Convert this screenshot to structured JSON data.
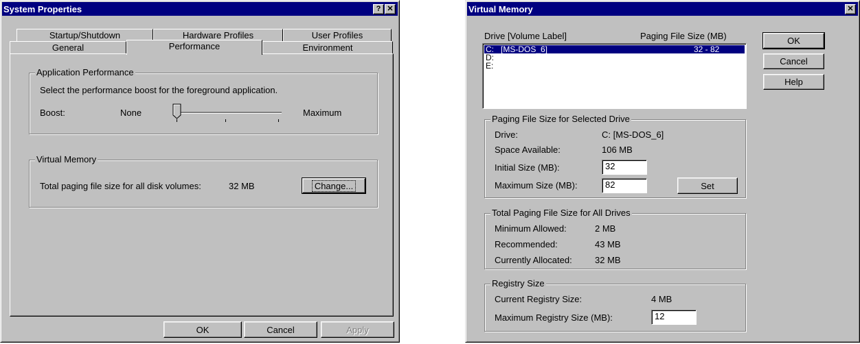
{
  "sysprops": {
    "title": "System Properties",
    "help_btn": "?",
    "close_btn": "✕",
    "tabs_back": [
      "Startup/Shutdown",
      "Hardware Profiles",
      "User Profiles"
    ],
    "tabs_front": [
      "General",
      "Performance",
      "Environment"
    ],
    "app_perf": {
      "legend": "Application Performance",
      "description": "Select the performance boost for the foreground application.",
      "boost_label": "Boost:",
      "none_label": "None",
      "max_label": "Maximum",
      "boost_value": 0
    },
    "vm": {
      "legend": "Virtual Memory",
      "text": "Total paging file size for all disk volumes:",
      "size": "32 MB",
      "change_btn": "Change..."
    },
    "ok": "OK",
    "cancel": "Cancel",
    "apply": "Apply"
  },
  "virtmem": {
    "title": "Virtual Memory",
    "close_btn": "✕",
    "col_drive": "Drive  [Volume Label]",
    "col_size": "Paging File Size (MB)",
    "drives": [
      {
        "drive": "C:",
        "label": "[MS-DOS_6]",
        "size": "32 - 82"
      },
      {
        "drive": "D:",
        "label": "",
        "size": ""
      },
      {
        "drive": "E:",
        "label": "",
        "size": ""
      }
    ],
    "ok": "OK",
    "cancel": "Cancel",
    "help": "Help",
    "selected": {
      "legend": "Paging File Size for Selected Drive",
      "drive_label": "Drive:",
      "drive_value": "C:  [MS-DOS_6]",
      "space_label": "Space Available:",
      "space_value": "106 MB",
      "initial_label": "Initial Size (MB):",
      "initial_value": "32",
      "max_label": "Maximum Size (MB):",
      "max_value": "82",
      "set_btn": "Set"
    },
    "total": {
      "legend": "Total Paging File Size for All Drives",
      "min_label": "Minimum Allowed:",
      "min_value": "2 MB",
      "rec_label": "Recommended:",
      "rec_value": "43 MB",
      "cur_label": "Currently Allocated:",
      "cur_value": "32 MB"
    },
    "registry": {
      "legend": "Registry Size",
      "cur_label": "Current Registry Size:",
      "cur_value": "4 MB",
      "max_label": "Maximum Registry Size (MB):",
      "max_value": "12"
    }
  }
}
